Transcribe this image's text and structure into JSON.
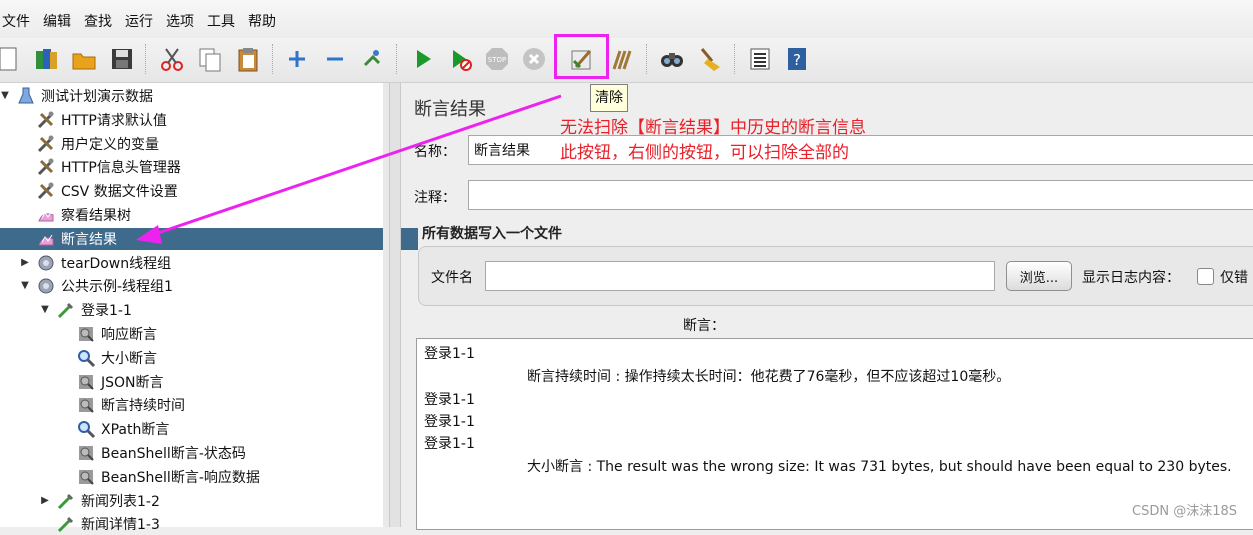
{
  "menu": [
    "文件",
    "编辑",
    "查找",
    "运行",
    "选项",
    "工具",
    "帮助"
  ],
  "toolbar": {
    "items": [
      "new-icon",
      "templates-icon",
      "open-icon",
      "save-icon",
      "cut-icon",
      "copy-icon",
      "paste-icon",
      "expand-icon",
      "collapse-icon",
      "toggle-icon",
      "start-icon",
      "start-no-pause-icon",
      "stop-icon",
      "shutdown-icon",
      "clear-icon",
      "clear-all-icon",
      "search-icon",
      "reset-search-icon",
      "function-helper-icon",
      "help-icon"
    ],
    "tooltip": "清除"
  },
  "tree": {
    "nodes": [
      {
        "label": "测试计划演示数据",
        "depth": 0,
        "toggle": "▼",
        "icon": "test-plan-icon"
      },
      {
        "label": "HTTP请求默认值",
        "depth": 1,
        "toggle": "",
        "icon": "config-tool-icon"
      },
      {
        "label": "用户定义的变量",
        "depth": 1,
        "toggle": "",
        "icon": "config-tool-icon"
      },
      {
        "label": "HTTP信息头管理器",
        "depth": 1,
        "toggle": "",
        "icon": "config-tool-icon"
      },
      {
        "label": "CSV 数据文件设置",
        "depth": 1,
        "toggle": "",
        "icon": "config-tool-icon"
      },
      {
        "label": "察看结果树",
        "depth": 1,
        "toggle": "",
        "icon": "listener-icon"
      },
      {
        "label": "断言结果",
        "depth": 1,
        "toggle": "",
        "icon": "listener-icon",
        "selected": true
      },
      {
        "label": "tearDown线程组",
        "depth": 1,
        "toggle": "▶",
        "icon": "thread-group-icon"
      },
      {
        "label": "公共示例-线程组1",
        "depth": 1,
        "toggle": "▼",
        "icon": "thread-group-icon"
      },
      {
        "label": "登录1-1",
        "depth": 2,
        "toggle": "▼",
        "icon": "sampler-icon"
      },
      {
        "label": "响应断言",
        "depth": 3,
        "toggle": "",
        "icon": "assertion-icon"
      },
      {
        "label": "大小断言",
        "depth": 3,
        "toggle": "",
        "icon": "magnifier-icon"
      },
      {
        "label": "JSON断言",
        "depth": 3,
        "toggle": "",
        "icon": "assertion-icon"
      },
      {
        "label": "断言持续时间",
        "depth": 3,
        "toggle": "",
        "icon": "assertion-icon"
      },
      {
        "label": "XPath断言",
        "depth": 3,
        "toggle": "",
        "icon": "magnifier-icon"
      },
      {
        "label": "BeanShell断言-状态码",
        "depth": 3,
        "toggle": "",
        "icon": "assertion-icon"
      },
      {
        "label": "BeanShell断言-响应数据",
        "depth": 3,
        "toggle": "",
        "icon": "assertion-icon"
      },
      {
        "label": "新闻列表1-2",
        "depth": 2,
        "toggle": "▶",
        "icon": "sampler-icon"
      },
      {
        "label": "新闻详情1-3",
        "depth": 2,
        "toggle": "",
        "icon": "sampler-icon"
      }
    ]
  },
  "panel": {
    "title": "断言结果",
    "name_label": "名称：",
    "name_value": "断言结果",
    "comment_label": "注释：",
    "comment_value": "",
    "file_group_title": "所有数据写入一个文件",
    "filename_label": "文件名",
    "filename_value": "",
    "browse_button": "浏览...",
    "log_content_label": "显示日志内容：",
    "errors_only_label": "仅错",
    "assertions_label": "断言：",
    "results": [
      {
        "text": "登录1-1",
        "indent": false
      },
      {
        "text": "断言持续时间 : 操作持续太长时间：他花费了76毫秒，但不应该超过10毫秒。",
        "indent": true
      },
      {
        "text": "登录1-1",
        "indent": false
      },
      {
        "text": "登录1-1",
        "indent": false
      },
      {
        "text": "登录1-1",
        "indent": false
      },
      {
        "text": "大小断言 : The result was the wrong size: It was 731 bytes, but should have been equal to 230 bytes.",
        "indent": true
      }
    ]
  },
  "annotation": {
    "line1": "无法扫除【断言结果】中历史的断言信息",
    "line2": "此按钮，右侧的按钮，可以扫除全部的",
    "color": "#e8202a",
    "arrow_color": "#ee22ee"
  },
  "watermark": "CSDN @沫沫18S"
}
